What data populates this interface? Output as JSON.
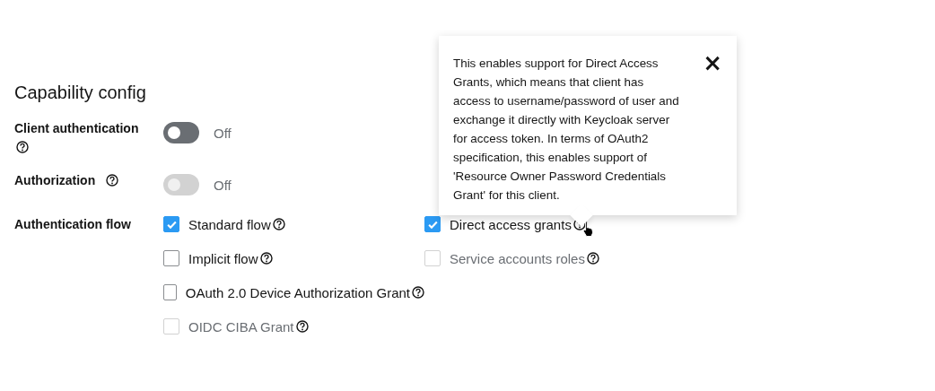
{
  "section": {
    "title": "Capability config"
  },
  "fields": [
    {
      "label": "Client authentication",
      "toggle": {
        "on": false,
        "disabled": false,
        "label": "Off"
      }
    },
    {
      "label": "Authorization",
      "toggle": {
        "on": false,
        "disabled": true,
        "label": "Off"
      }
    }
  ],
  "authentication_flow": {
    "label": "Authentication flow",
    "rows": [
      [
        {
          "label": "Standard flow",
          "checked": true,
          "disabled": false
        },
        {
          "label": "Direct access grants",
          "checked": true,
          "disabled": false
        }
      ],
      [
        {
          "label": "Implicit flow",
          "checked": false,
          "disabled": false
        },
        {
          "label": "Service accounts roles",
          "checked": false,
          "disabled": true
        }
      ],
      [
        {
          "label": "OAuth 2.0 Device Authorization Grant",
          "checked": false,
          "disabled": false
        }
      ],
      [
        {
          "label": "OIDC CIBA Grant",
          "checked": false,
          "disabled": true
        }
      ]
    ]
  },
  "popover": {
    "text": "This enables support for Direct Access Grants, which means that client has access to username/password of user and exchange it directly with Keycloak server for access token. In terms of OAuth2 specification, this enables support of 'Resource Owner Password Credentials Grant' for this client.",
    "close": "×"
  }
}
